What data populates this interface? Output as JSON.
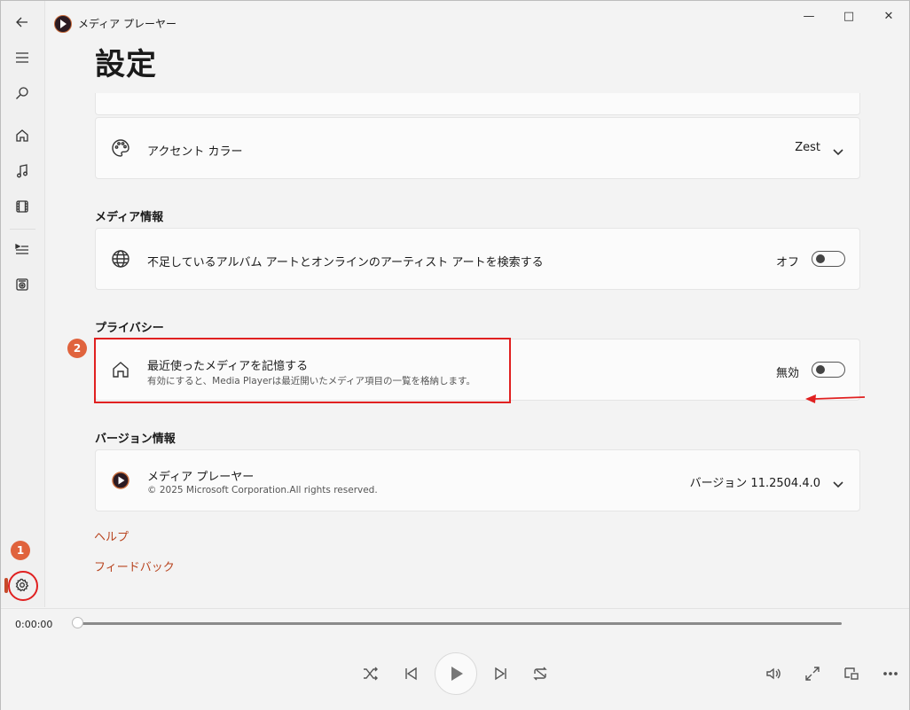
{
  "app": {
    "title": "メディア プレーヤー"
  },
  "page": {
    "title": "設定"
  },
  "accent": {
    "label": "アクセント カラー",
    "value": "Zest"
  },
  "media_info": {
    "section": "メディア情報",
    "label": "不足しているアルバム アートとオンラインのアーティスト アートを検索する",
    "state": "オフ"
  },
  "privacy": {
    "section": "プライバシー",
    "label": "最近使ったメディアを記憶する",
    "desc": "有効にすると、Media Playerは最近開いたメディア項目の一覧を格納します。",
    "state": "無効"
  },
  "version": {
    "section": "バージョン情報",
    "app_name": "メディア プレーヤー",
    "copyright": "© 2025 Microsoft Corporation.All rights reserved.",
    "version": "バージョン 11.2504.4.0"
  },
  "links": {
    "help": "ヘルプ",
    "feedback": "フィードバック"
  },
  "player": {
    "time": "0:00:00"
  },
  "annotations": {
    "badge1": "1",
    "badge2": "2"
  },
  "colors": {
    "accent": "#c64a2a",
    "annotation": "#e02020",
    "badge": "#e0633d"
  }
}
